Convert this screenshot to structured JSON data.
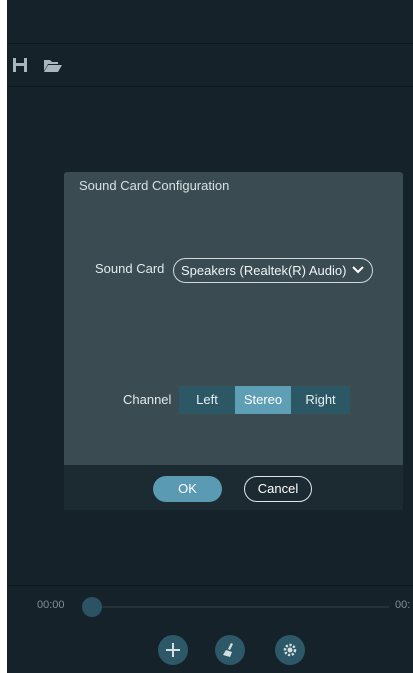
{
  "toolbar": {
    "icons": [
      "save-icon",
      "folder-open-icon"
    ]
  },
  "dialog": {
    "title": "Sound Card Configuration",
    "sound_card_label": "Sound Card",
    "sound_card_value": "Speakers (Realtek(R) Audio)",
    "channel_label": "Channel",
    "channel_options": [
      "Left",
      "Stereo",
      "Right"
    ],
    "channel_selected": "Stereo",
    "ok_label": "OK",
    "cancel_label": "Cancel"
  },
  "timeline": {
    "start_time": "00:00",
    "end_time": "00:",
    "progress": 0
  },
  "bottombar": {
    "icons": [
      "add-icon",
      "broom-icon",
      "gear-icon"
    ]
  },
  "colors": {
    "background": "#16222a",
    "dialog": "#3a4c52",
    "accent": "#5e9fb5"
  }
}
